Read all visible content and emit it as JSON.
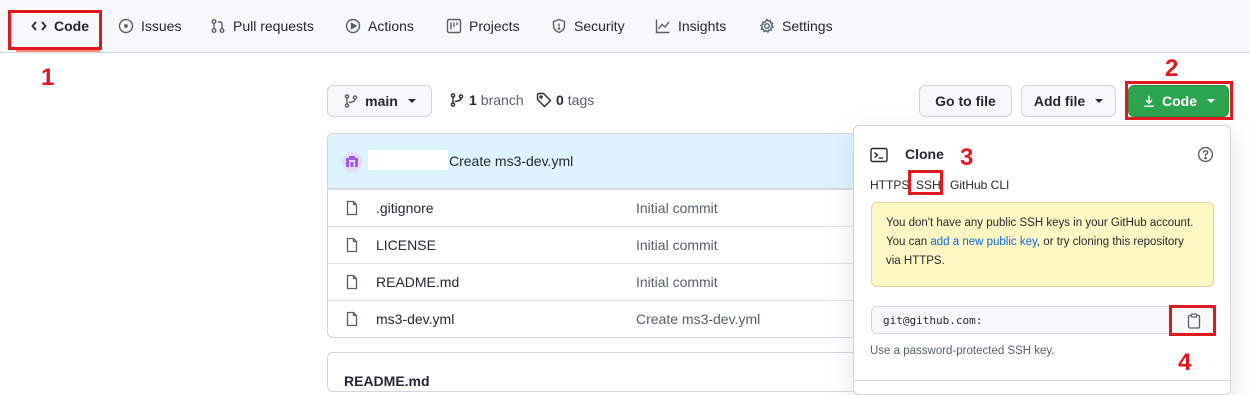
{
  "nav": {
    "tabs": [
      {
        "label": "Code",
        "icon": "code-icon"
      },
      {
        "label": "Issues",
        "icon": "issue-icon"
      },
      {
        "label": "Pull requests",
        "icon": "pull-request-icon"
      },
      {
        "label": "Actions",
        "icon": "play-icon"
      },
      {
        "label": "Projects",
        "icon": "project-icon"
      },
      {
        "label": "Security",
        "icon": "shield-icon"
      },
      {
        "label": "Insights",
        "icon": "graph-icon"
      },
      {
        "label": "Settings",
        "icon": "gear-icon"
      }
    ],
    "active": "Code"
  },
  "toolbar": {
    "branch_name": "main",
    "branch_count": "1",
    "branch_word": "branch",
    "tag_count": "0",
    "tag_word": "tags",
    "goto_file": "Go to file",
    "add_file": "Add file",
    "code_button": "Code"
  },
  "commit": {
    "message": "Create ms3-dev.yml"
  },
  "files": [
    {
      "name": ".gitignore",
      "message": "Initial commit"
    },
    {
      "name": "LICENSE",
      "message": "Initial commit"
    },
    {
      "name": "README.md",
      "message": "Initial commit"
    },
    {
      "name": "ms3-dev.yml",
      "message": "Create ms3-dev.yml"
    }
  ],
  "readme": {
    "title": "README.md"
  },
  "clone": {
    "title": "Clone",
    "tabs": [
      "HTTPS",
      "SSH",
      "GitHub CLI"
    ],
    "selected_tab": "SSH",
    "notice_part1": "You don't have any public SSH keys in your GitHub account. You can ",
    "notice_link": "add a new public key",
    "notice_part2": ", or try cloning this repository via HTTPS.",
    "url": "git@github.com:",
    "hint": "Use a password-protected SSH key."
  },
  "annotations": [
    "1",
    "2",
    "3",
    "4"
  ],
  "colors": {
    "annotation": "#e0191f",
    "primary_button": "#2da44e",
    "link": "#0969da",
    "notice_bg": "#fff8c5",
    "commit_bar": "#ddf4ff"
  }
}
